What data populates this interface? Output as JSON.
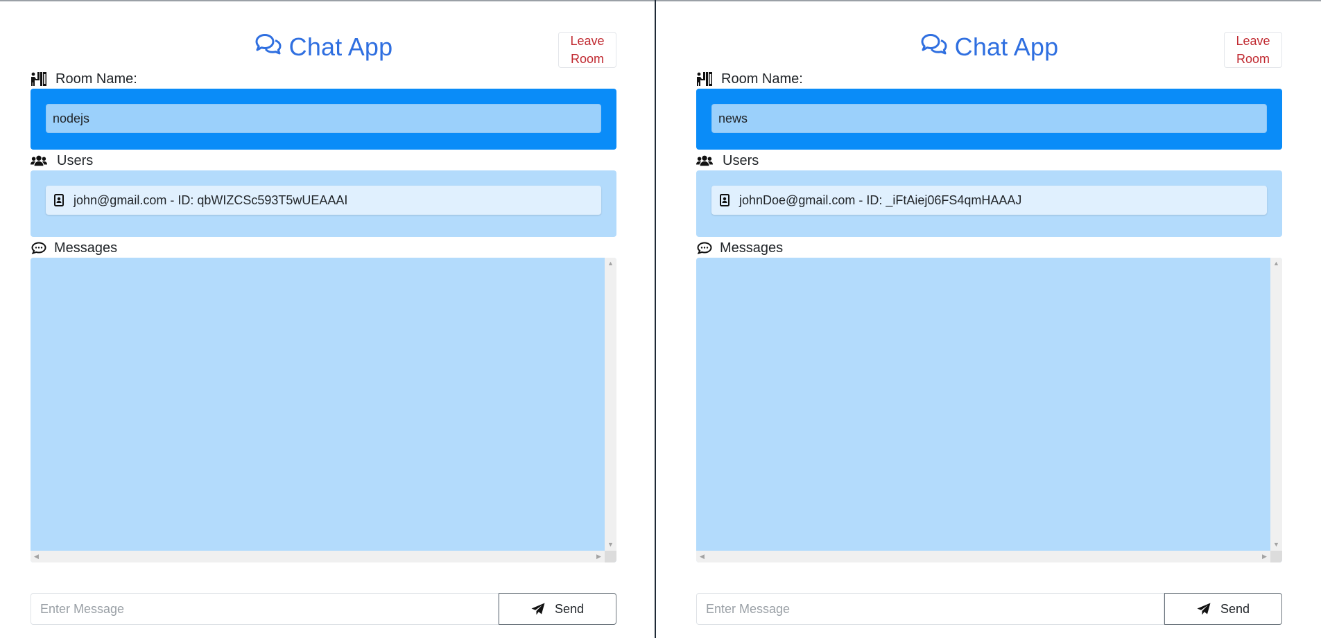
{
  "app": {
    "title": "Chat App",
    "accent": "#2f6fe0",
    "danger": "#c0282f",
    "room_color": "#0a8cf8",
    "panel_color": "#b3dbfc"
  },
  "panes": [
    {
      "header": {
        "title": "Chat App",
        "leave_line1": "Leave",
        "leave_line2": "Room"
      },
      "room": {
        "label": "Room Name:",
        "value": "nodejs"
      },
      "users": {
        "label": "Users",
        "items": [
          {
            "text": "john@gmail.com - ID: qbWIZCSc593T5wUEAAAI"
          }
        ]
      },
      "messages": {
        "label": "Messages"
      },
      "compose": {
        "placeholder": "Enter Message",
        "send_label": "Send"
      }
    },
    {
      "header": {
        "title": "Chat App",
        "leave_line1": "Leave",
        "leave_line2": "Room"
      },
      "room": {
        "label": "Room Name:",
        "value": "news"
      },
      "users": {
        "label": "Users",
        "items": [
          {
            "text": "johnDoe@gmail.com - ID: _iFtAiej06FS4qmHAAAJ"
          }
        ]
      },
      "messages": {
        "label": "Messages"
      },
      "compose": {
        "placeholder": "Enter Message",
        "send_label": "Send"
      }
    }
  ]
}
